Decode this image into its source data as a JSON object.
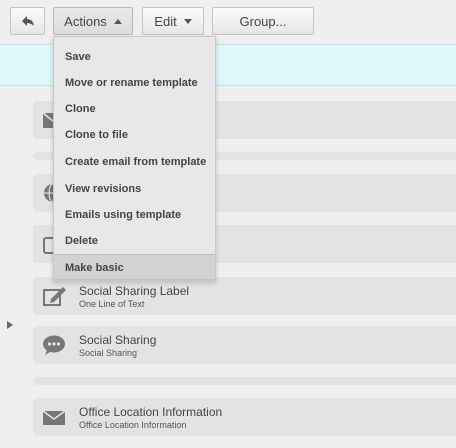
{
  "toolbar": {
    "back_icon": "back-arrow-icon",
    "actions_label": "Actions",
    "edit_label": "Edit",
    "group_label": "Group..."
  },
  "actions_menu": {
    "items": [
      {
        "label": "Save"
      },
      {
        "label": "Move or rename template"
      },
      {
        "label": "Clone"
      },
      {
        "label": "Clone to file"
      },
      {
        "label": "Create email from template"
      },
      {
        "label": "View revisions"
      },
      {
        "label": "Emails using template"
      },
      {
        "label": "Delete"
      },
      {
        "label": "Make basic",
        "highlighted": true
      }
    ]
  },
  "modules": [
    {
      "icon": "envelope-icon"
    },
    {
      "icon": "globe-icon"
    },
    {
      "icon": "box-icon"
    },
    {
      "title": "Social Sharing Label",
      "subtitle": "One Line of Text",
      "icon": "edit-pencil-icon"
    },
    {
      "title": "Social Sharing",
      "subtitle": "Social Sharing",
      "icon": "chat-bubble-icon"
    },
    {
      "title": "Office Location Information",
      "subtitle": "Office Location Information",
      "icon": "envelope-icon"
    }
  ],
  "colors": {
    "page_bg": "#efefef",
    "info_band": "#dff6fb",
    "row_bg": "#e3e3e3",
    "menu_bg": "#e8e8e8",
    "menu_highlight": "#d2d2d2"
  }
}
